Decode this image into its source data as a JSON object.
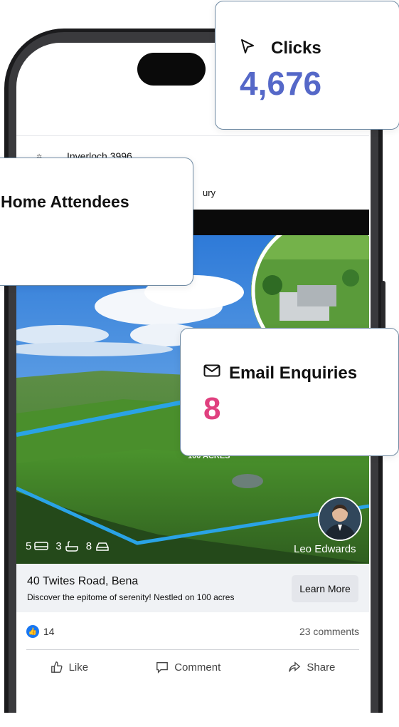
{
  "phone": {
    "island": "dynamic-island"
  },
  "post": {
    "location": "Inverloch 3996",
    "location_sub": "ury",
    "photo_label": "100 ACRES",
    "specs": {
      "beds": "5",
      "baths": "3",
      "cars": "8"
    },
    "agent_name": "Leo Edwards",
    "listing_title": "40 Twites Road, Bena",
    "listing_desc": "Discover the epitome of serenity! Nestled on 100 acres",
    "learn_more": "Learn More",
    "likes": "14",
    "comments": "23 comments",
    "actions": {
      "like": "Like",
      "comment": "Comment",
      "share": "Share"
    }
  },
  "cards": {
    "clicks": {
      "label": "Clicks",
      "value": "4,676",
      "icon": "cursor-icon",
      "color": "#5568c8"
    },
    "attendees": {
      "label": "Home Attendees"
    },
    "email": {
      "label": "Email Enquiries",
      "value": "8",
      "icon": "envelope-icon",
      "color": "#e0407f"
    }
  },
  "colors": {
    "facebook_blue": "#1877f2",
    "card_border": "#6f8aa3"
  }
}
